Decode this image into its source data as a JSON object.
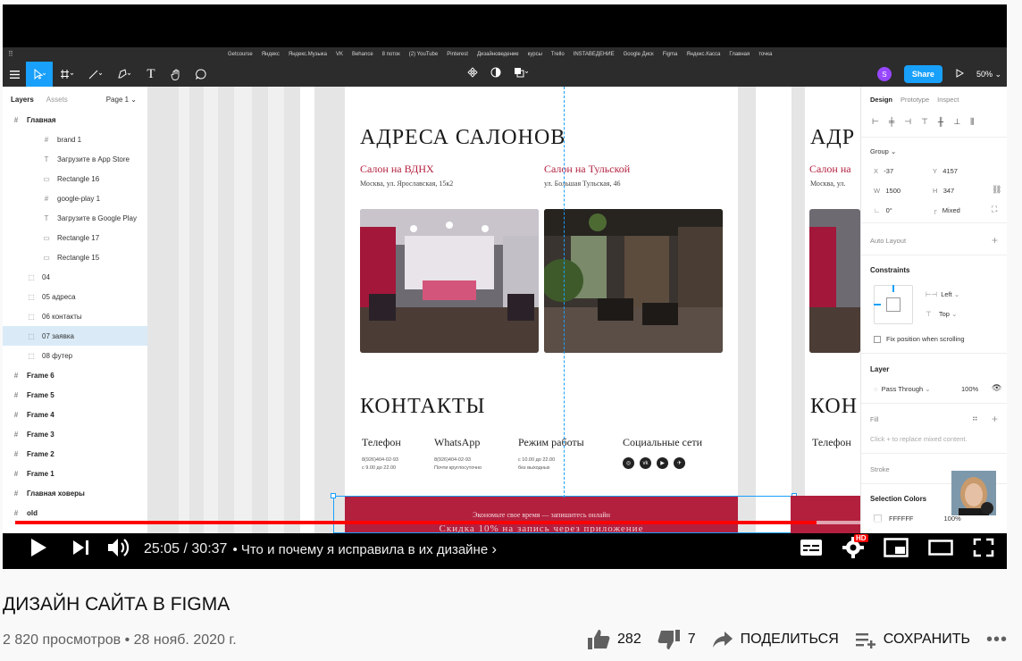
{
  "browser": {
    "bookmarks": [
      "Getcourse",
      "Яндекс",
      "Яндекс.Музыка",
      "VK",
      "Behance",
      "8 поток",
      "(2) YouTube",
      "Pinterest",
      "Дизайноведение",
      "курсы",
      "Trello",
      "INSTAВЕДЕНИЕ",
      "Google Диск",
      "Figma",
      "Яндекс.Касса",
      "Главная",
      "точка"
    ]
  },
  "figma": {
    "share_label": "Share",
    "user_initial": "S",
    "zoom": "50%",
    "layers_panel": {
      "tab_layers": "Layers",
      "tab_assets": "Assets",
      "page_selector": "Page 1",
      "items": [
        {
          "label": "Главная",
          "kind": "frame",
          "indent": 0,
          "bold": true
        },
        {
          "label": "brand 1",
          "kind": "frame",
          "indent": 2
        },
        {
          "label": "Загрузите в App Store",
          "kind": "text",
          "indent": 2
        },
        {
          "label": "Rectangle 16",
          "kind": "rect",
          "indent": 2
        },
        {
          "label": "google-play 1",
          "kind": "frame",
          "indent": 2
        },
        {
          "label": "Загрузите в Google Play",
          "kind": "text",
          "indent": 2
        },
        {
          "label": "Rectangle 17",
          "kind": "rect",
          "indent": 2
        },
        {
          "label": "Rectangle 15",
          "kind": "rect",
          "indent": 2
        },
        {
          "label": "04",
          "kind": "group",
          "indent": 1
        },
        {
          "label": "05 адреса",
          "kind": "group",
          "indent": 1
        },
        {
          "label": "06 контакты",
          "kind": "group",
          "indent": 1
        },
        {
          "label": "07 заявка",
          "kind": "group",
          "indent": 1,
          "selected": true
        },
        {
          "label": "08 футер",
          "kind": "group",
          "indent": 1
        },
        {
          "label": "Frame 6",
          "kind": "frame",
          "indent": 0,
          "bold": true
        },
        {
          "label": "Frame 5",
          "kind": "frame",
          "indent": 0,
          "bold": true
        },
        {
          "label": "Frame 4",
          "kind": "frame",
          "indent": 0,
          "bold": true
        },
        {
          "label": "Frame 3",
          "kind": "frame",
          "indent": 0,
          "bold": true
        },
        {
          "label": "Frame 2",
          "kind": "frame",
          "indent": 0,
          "bold": true
        },
        {
          "label": "Frame 1",
          "kind": "frame",
          "indent": 0,
          "bold": true
        },
        {
          "label": "Главная ховеры",
          "kind": "frame",
          "indent": 0,
          "bold": true
        },
        {
          "label": "old",
          "kind": "frame",
          "indent": 0,
          "bold": true
        }
      ]
    },
    "canvas": {
      "addresses_title": "АДРЕСА САЛОНОВ",
      "salon1_name": "Салон на ВДНХ",
      "salon1_addr": "Москва, ул. Ярославская, 15к2",
      "salon2_name": "Салон на Тульской",
      "salon2_addr": "ул. Большая Тульская, 46",
      "contacts_title": "КОНТАКТЫ",
      "phone_h": "Телефон",
      "phone_l1": "8(926)404-02-93",
      "phone_l2": "с 9.00 до 22.00",
      "wa_h": "WhatsApp",
      "wa_l1": "8(926)404-02-93",
      "wa_l2": "Почти круглосуточно",
      "hours_h": "Режим работы",
      "hours_l1": "с 10.00 до 22.00",
      "hours_l2": "без выходных",
      "social_h": "Социальные сети",
      "band_line1": "Экономьте свое время — запишитесь онлайн",
      "band_line2": "Скидка 10% на запись через приложение",
      "right_title_partial": "АДР",
      "right_contacts_partial": "КОН",
      "right_salon_partial": "Салон на",
      "right_addr_partial": "Москва, ул.",
      "right_phone_partial": "Телефон"
    },
    "design_panel": {
      "tab_design": "Design",
      "tab_prototype": "Prototype",
      "tab_inspect": "Inspect",
      "group_label": "Group",
      "x_label": "X",
      "x_value": "-37",
      "y_label": "Y",
      "y_value": "4157",
      "w_label": "W",
      "w_value": "1500",
      "h_label": "H",
      "h_value": "347",
      "rotation": "0°",
      "radius": "Mixed",
      "auto_layout": "Auto Layout",
      "constraints": "Constraints",
      "constraint_h": "Left",
      "constraint_v": "Top",
      "fix_position": "Fix position when scrolling",
      "layer": "Layer",
      "blend": "Pass Through",
      "opacity": "100%",
      "fill": "Fill",
      "fill_hint": "Click + to replace mixed content.",
      "stroke": "Stroke",
      "selection_colors": "Selection Colors",
      "color1_hex": "FFFFFF",
      "color1_opacity": "100%"
    }
  },
  "player": {
    "time_current": "25:05",
    "time_total": "30:37",
    "time_sep": " / ",
    "chapter": "Что и почему я исправила в их дизайне",
    "progress": 0.818,
    "buffered": 0.91,
    "hd_badge": "HD"
  },
  "video": {
    "title": "ДИЗАЙН САЙТА В FIGMA",
    "views": "2 820 просмотров",
    "date": "28 нояб. 2020 г.",
    "likes": "282",
    "dislikes": "7",
    "share_label": "ПОДЕЛИТЬСЯ",
    "save_label": "СОХРАНИТЬ"
  },
  "colors": {
    "brand_red": "#b3203e",
    "figma_blue": "#18a0fb",
    "yt_red": "#ff0000"
  }
}
